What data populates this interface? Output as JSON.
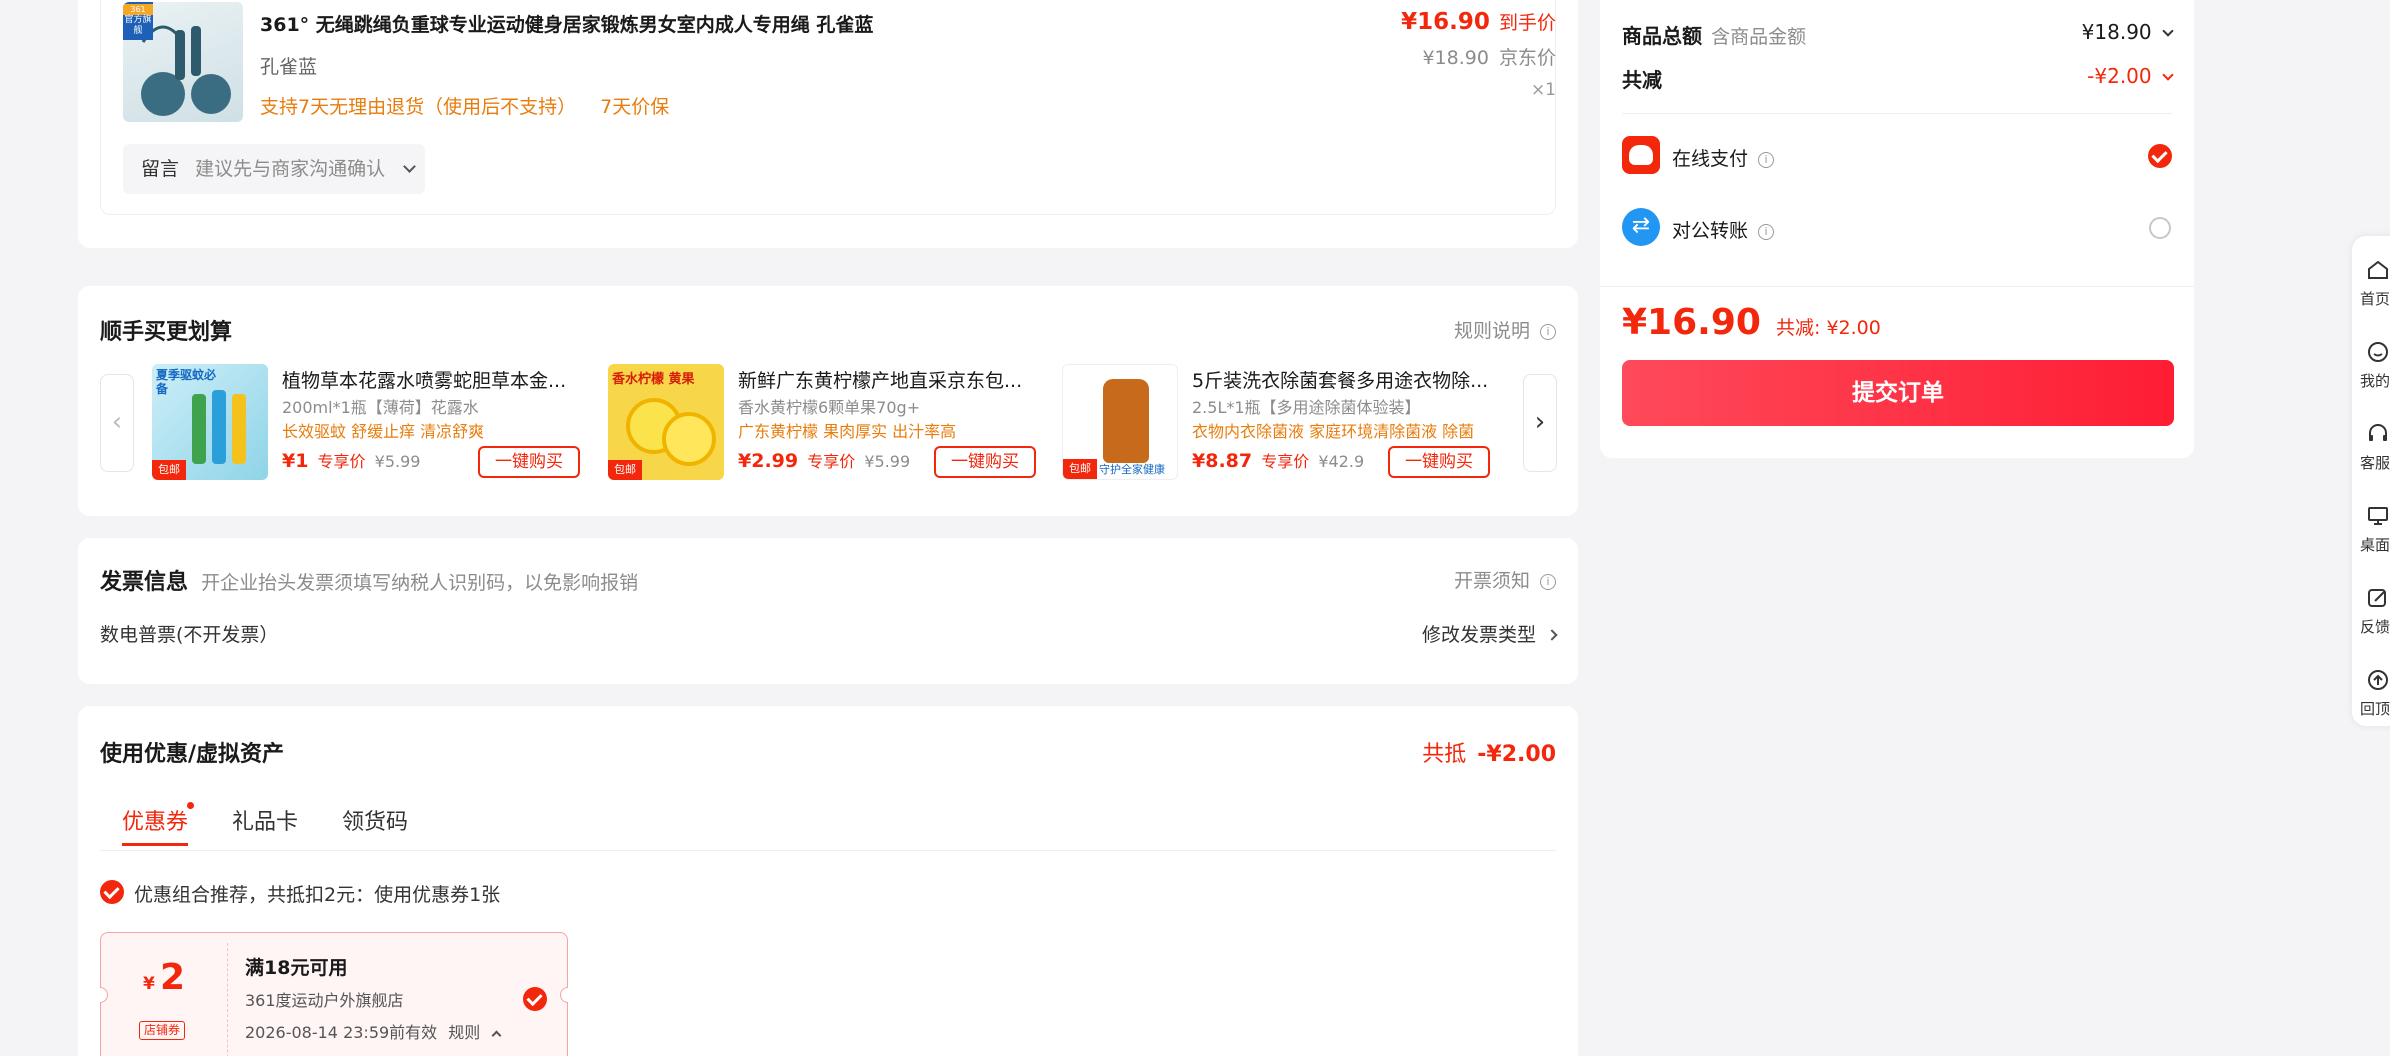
{
  "product": {
    "badge_top": "361",
    "badge_label": "官方旗舰",
    "title": "361° 无绳跳绳负重球专业运动健身居家锻炼男女室内成人专用绳 孔雀蓝",
    "variant": "孔雀蓝",
    "service": "支持7天无理由退货（使用后不支持）",
    "price_protect": "7天价保",
    "price": "¥16.90",
    "price_tag": "到手价",
    "jd_price": "¥18.90",
    "jd_price_tag": "京东价",
    "qty": "×1"
  },
  "message": {
    "label": "留言",
    "placeholder": "建议先与商家沟通确认"
  },
  "bundle": {
    "title": "顺手买更划算",
    "rules": "规则说明",
    "prev": "‹",
    "next": "›",
    "items": [
      {
        "name": "植物草本花露水喷雾蛇胆草本金...",
        "spec": "200ml*1瓶【薄荷】花露水",
        "tags": "长效驱蚊 舒缓止痒 清凉舒爽",
        "price": "¥1",
        "tag": "专享价",
        "orig": "¥5.99",
        "button": "一键购买",
        "img_text": "夏季驱蚊必备",
        "badge": "包邮",
        "color": "#2fb7d6"
      },
      {
        "name": "新鲜广东黄柠檬产地直采京东包...",
        "spec": "香水黄柠檬6颗单果70g+",
        "tags": "广东黄柠檬 果肉厚实 出汁率高",
        "price": "¥2.99",
        "tag": "专享价",
        "orig": "¥5.99",
        "button": "一键购买",
        "img_text": "香水柠檬 黄果",
        "badge": "包邮",
        "color": "#f5c21a"
      },
      {
        "name": "5斤装洗衣除菌套餐多用途衣物除...",
        "spec": "2.5L*1瓶【多用途除菌体验装】",
        "tags": "衣物内衣除菌液 家庭环境清除菌液 除菌",
        "price": "¥8.87",
        "tag": "专享价",
        "orig": "¥42.9",
        "button": "一键购买",
        "img_text": "守护全家健康",
        "badge": "包邮",
        "color": "#c86a1c"
      }
    ]
  },
  "invoice": {
    "title": "发票信息",
    "hint": "开企业抬头发票须填写纳税人识别码，以免影响报销",
    "notice": "开票须知",
    "type": "数电普票(不开发票）",
    "change": "修改发票类型"
  },
  "coupons": {
    "title": "使用优惠/虚拟资产",
    "total_label": "共抵",
    "total_value": "-¥2.00",
    "tabs": [
      "优惠券",
      "礼品卡",
      "领货码"
    ],
    "recommend": "优惠组合推荐，共抵扣2元：使用优惠券1张",
    "coupon": {
      "currency": "¥",
      "amount": "2",
      "type": "店铺券",
      "condition": "满18元可用",
      "shop": "361度运动户外旗舰店",
      "expire": "2026-08-14 23:59前有效",
      "rules": "规则"
    }
  },
  "summary": {
    "total_label": "商品总额",
    "total_sub": "含商品金额",
    "total_value": "¥18.90",
    "discount_label": "共减",
    "discount_value": "-¥2.00",
    "pay_online": "在线支付",
    "pay_transfer": "对公转账",
    "final_price": "¥16.90",
    "final_discount": "共减: ¥2.00",
    "submit": "提交订单"
  },
  "sidebar": {
    "items": [
      "首页",
      "我的",
      "客服",
      "桌面",
      "反馈",
      "回顶"
    ]
  },
  "colors": {
    "accent": "#f2270c",
    "orange": "#e87d0d",
    "blue": "#2196f3"
  }
}
